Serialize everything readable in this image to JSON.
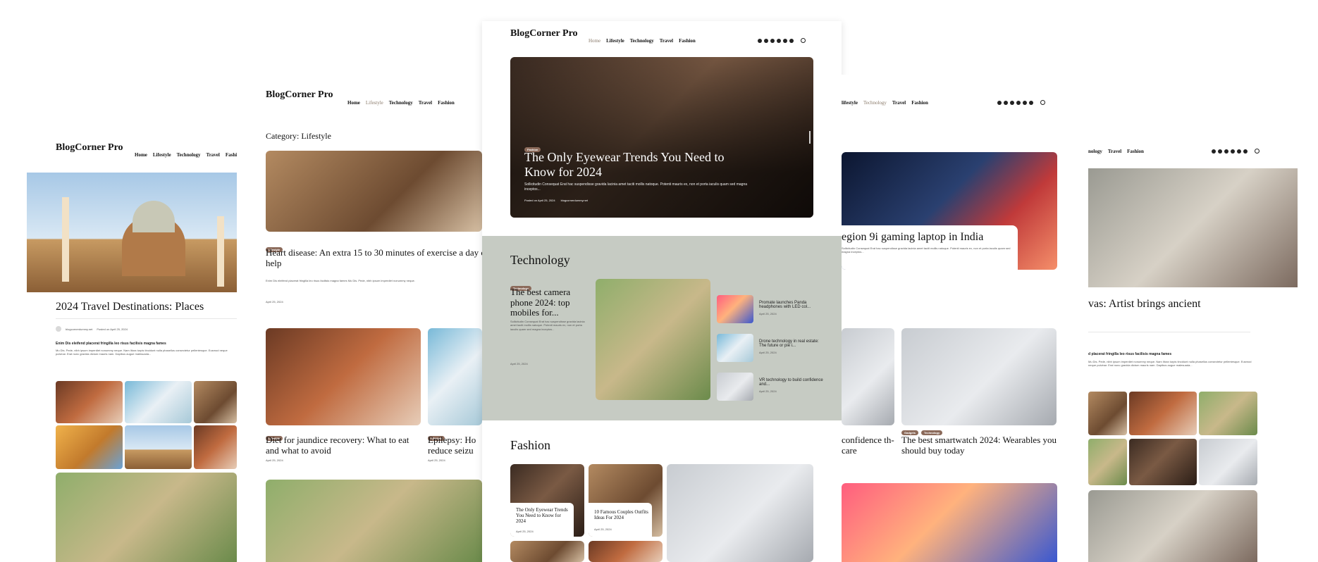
{
  "brand": {
    "name": "BlogCorner Pro"
  },
  "nav": {
    "items": [
      "Home",
      "Lifestyle",
      "Technology",
      "Travel",
      "Fashion"
    ],
    "right_items": [
      "lifestyle",
      "Technology",
      "Travel",
      "Fashion"
    ],
    "right2_items": [
      "nology",
      "Travel",
      "Fashion"
    ]
  },
  "left_panel": {
    "headline": "2024 Travel Destinations: Places",
    "meta_author": "blogcornerdummy.net",
    "meta_date": "Posted on April 25, 2024",
    "subheading": "Enim Dis eleifend placerat fringilla leo risus facilisis magna fames",
    "body_text": "Mu Dis. Pede, nibh ipsum imperdiet nonummy neque. Nam litora turpis tincidunt nulla phasellus consectetur pellentesque. Eusmod neque pulvinar. Erat nunc gravida dictum mauris nam. Dapibus augue malesuada..."
  },
  "mid_left_panel": {
    "category_label": "Category: Lifestyle",
    "post1_badge": "Lifestyle",
    "post1_title": "Heart disease: An extra 15 to 30 minutes of exercise a day can help",
    "post1_excerpt": "Enim Dis eleifend placerat fringilla leo risus facilisis magna fames Mu Dis. Pede, nibh ipsum imperdiet nonummy neque.",
    "post1_date": "April 25, 2024",
    "post2_badge": "Lifestyle",
    "post2_title": "Diet for jaundice recovery: What to eat and what to avoid",
    "post2_date": "April 25, 2024",
    "post3_badge": "Lifestyle",
    "post3_title": "Epilepsy: Ho reduce seizu",
    "post3_date": "April 25, 2024"
  },
  "hero": {
    "badge": "Fashion",
    "title": "The Only Eyewear Trends You Need to Know for 2024",
    "excerpt": "Sollicitudin Consequat Erat hac suspendisse gravida lacinia amet taciti mollis natoque. Potenti mauris ex, non et porta iaculis quam sed magna inceptos...",
    "meta_posted": "Posted on April 25, 2024",
    "meta_author": "blogcornerdummy.net"
  },
  "technology": {
    "heading": "Technology",
    "main_badge": "Technology",
    "main_title": "The best camera phone 2024: top mobiles for...",
    "main_excerpt": "Sollicitudin Consequat Erat hac suspendisse gravida lacinia amet taciti mollis natoque. Potenti mauris ex, non et porta iaculis quam sed magna inceptos...",
    "main_date": "April 25, 2024",
    "side_items": [
      {
        "title": "Promate launches Panda headphones with LED col...",
        "date": "April 25, 2024"
      },
      {
        "title": "Drone technology in real estate: The future or pie i...",
        "date": "April 25, 2024"
      },
      {
        "title": "VR technology to build confidence and...",
        "date": "April 25, 2024"
      }
    ]
  },
  "fashion": {
    "heading": "Fashion",
    "cards": [
      {
        "title": "The Only Eyewear Trends You Need to Know for 2024",
        "date": "April 25, 2024"
      },
      {
        "title": "10 Famous Couples Outfits Ideas For 2024",
        "date": "April 25, 2024"
      }
    ]
  },
  "right_panel": {
    "headline": "egion 9i gaming laptop in India",
    "excerpt": "Sollicitudin Consequat Erat hac suspendisse gravida lacinia amet taciti mollis natoque. Potenti mauris ex, non et porta iaculis quam sed magna inceptos...",
    "card2_badge1": "Gadgets",
    "card2_badge2": "Technology",
    "card2_title": "The best smartwatch 2024: Wearables you should buy today",
    "card1_title": "confidence th-care"
  },
  "far_right_panel": {
    "headline": "vas: Artist brings ancient",
    "subheading": "d placerat fringilla leo risus facilisis magna fames"
  },
  "colors": {
    "sage": "#c6cbc3",
    "badge": "#8b6a5a"
  }
}
